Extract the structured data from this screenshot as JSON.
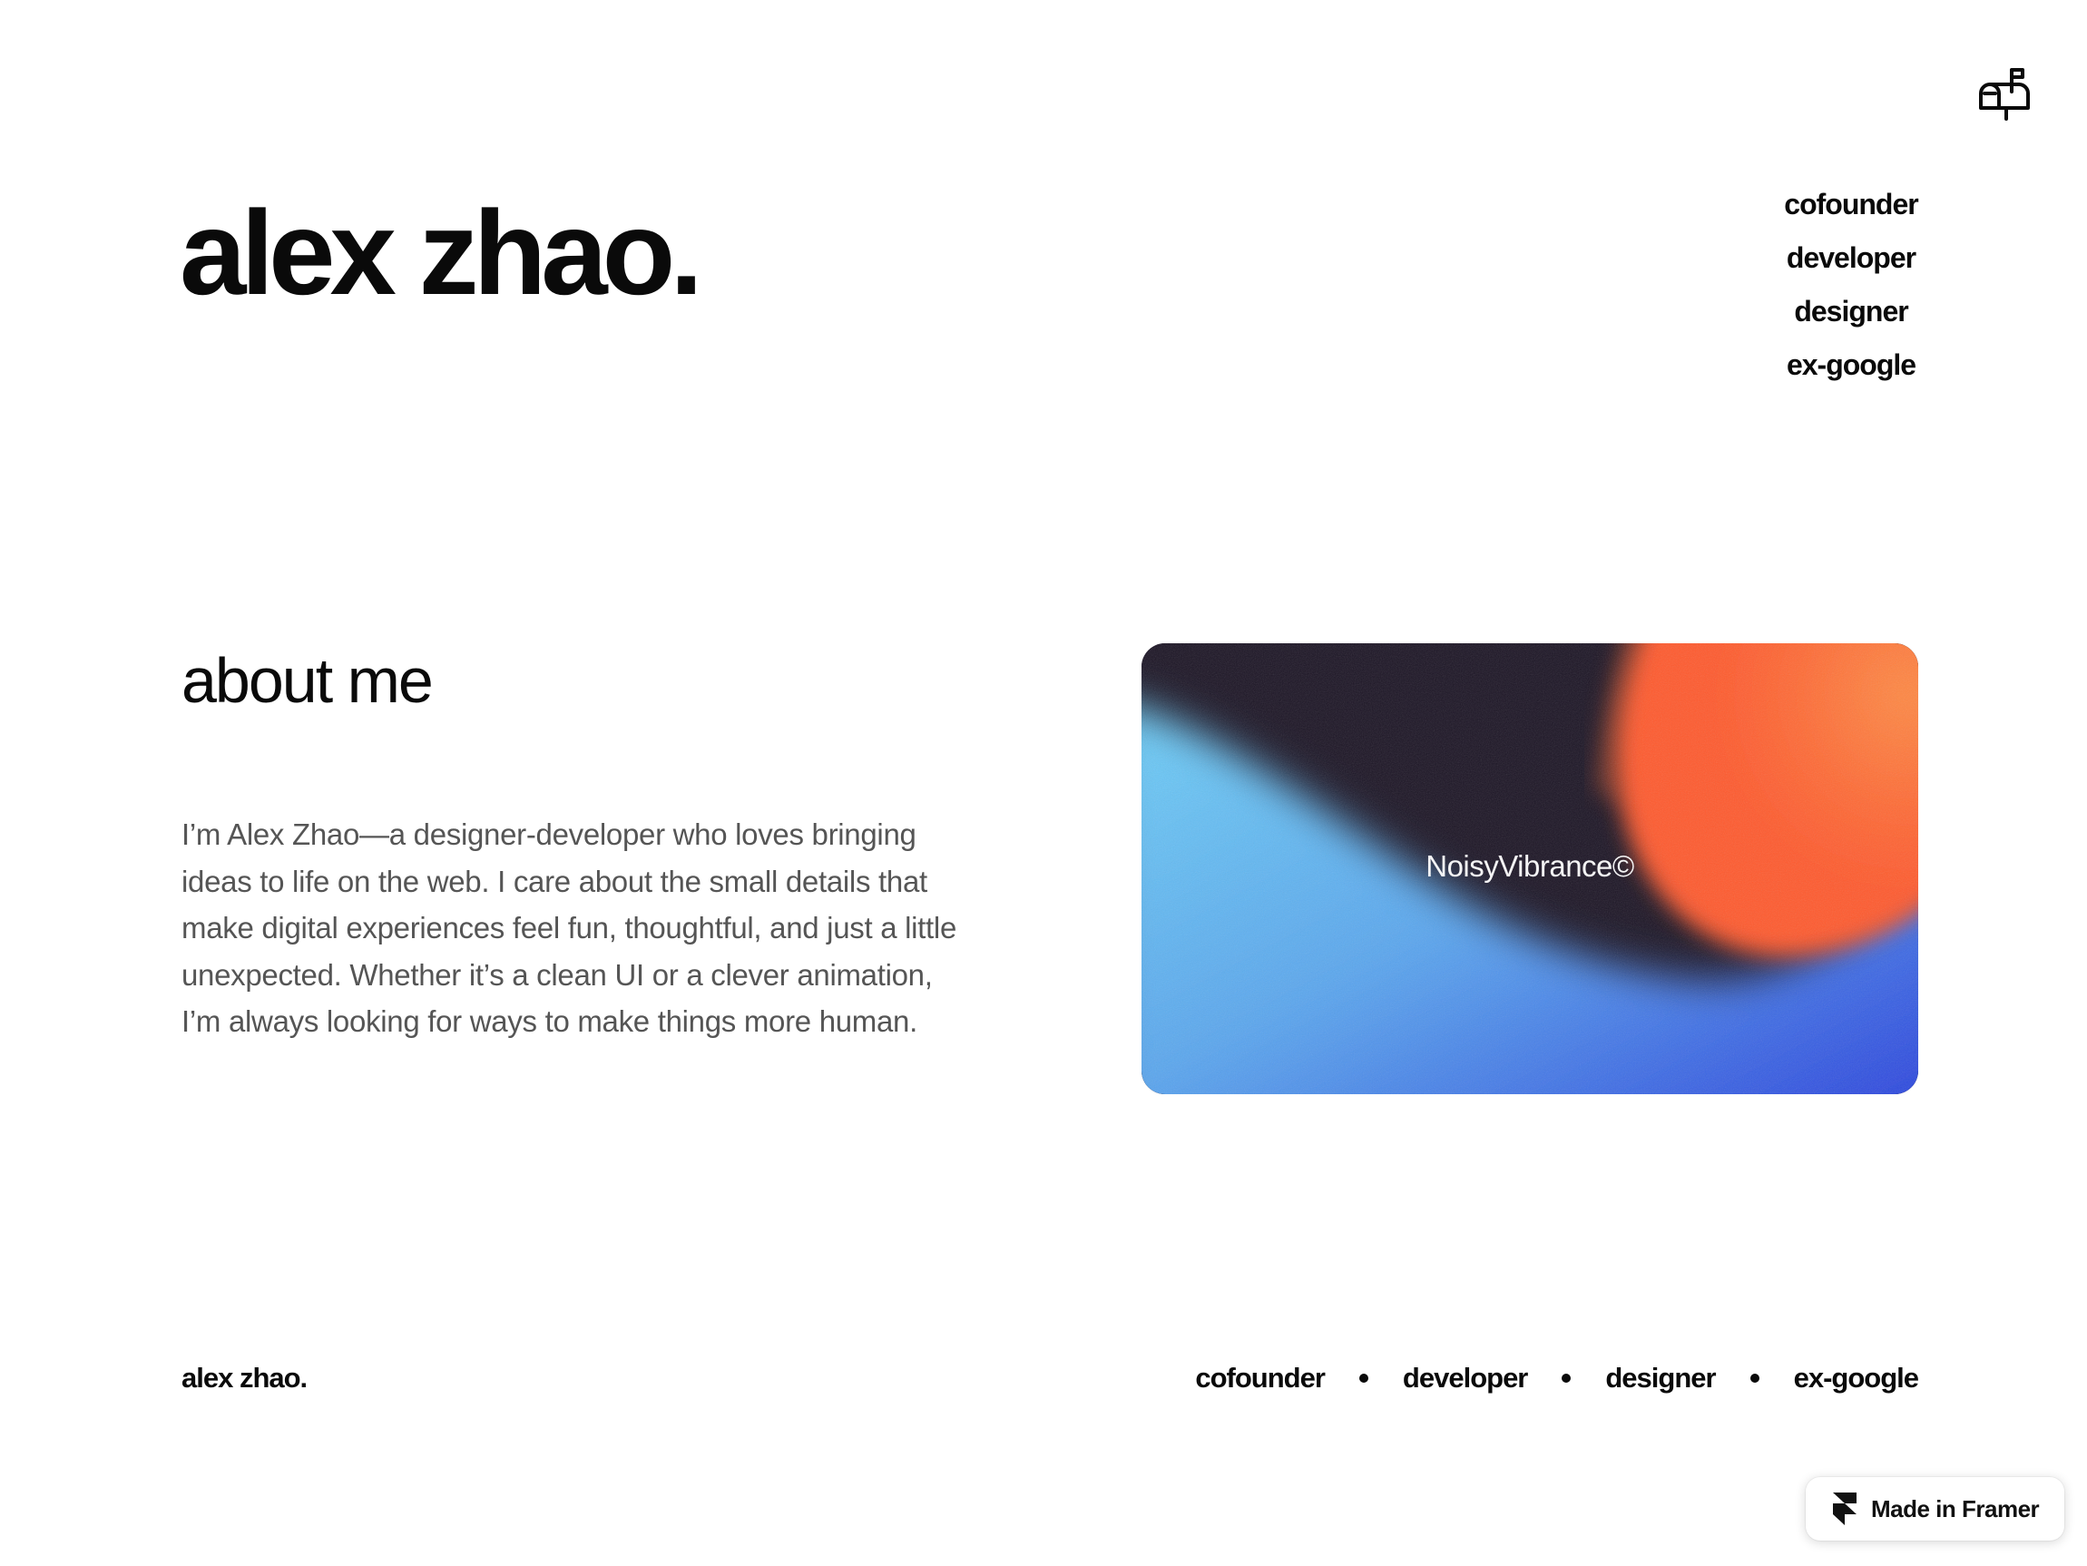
{
  "header": {
    "mail_icon": "mailbox-icon"
  },
  "hero": {
    "title": "alex zhao.",
    "roles": [
      "cofounder",
      "developer",
      "designer",
      "ex-google"
    ]
  },
  "about": {
    "title": "about me",
    "text": "I’m Alex Zhao—a designer-developer who loves bringing ideas to life on the web. I care about the small details that make digital experiences feel fun, thoughtful, and just a little unexpected. Whether it’s a clean UI or a clever animation, I’m always looking for ways to make things more human.",
    "card_label": "NoisyVibrance©",
    "card_colors": {
      "dark": "#1c1525",
      "orange": "#ff6a35",
      "light_blue": "#66c6f2",
      "deep_blue": "#2a3fe0"
    }
  },
  "footer": {
    "name": "alex zhao.",
    "roles": [
      "cofounder",
      "developer",
      "designer",
      "ex-google"
    ]
  },
  "badge": {
    "label": "Made in Framer",
    "icon": "framer-logo-icon"
  }
}
